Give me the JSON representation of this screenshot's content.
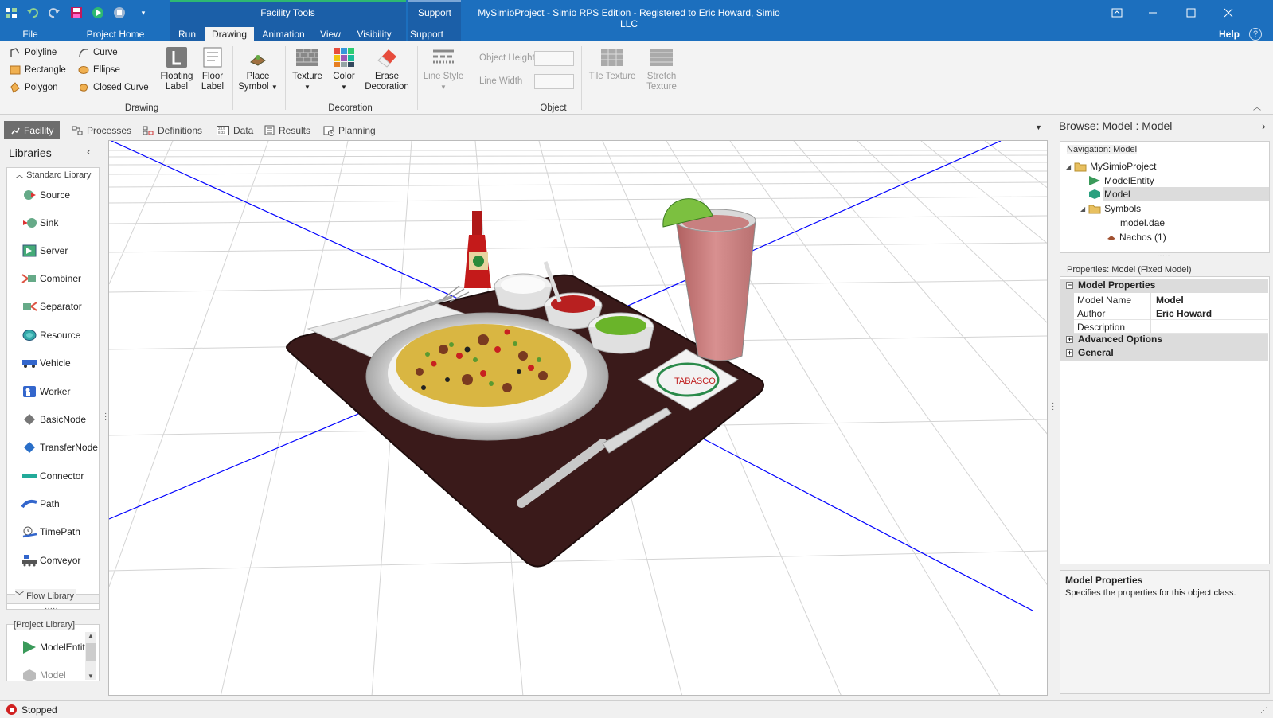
{
  "window": {
    "title": "MySimioProject - Simio RPS Edition - Registered to Eric Howard, Simio LLC",
    "context_facility": "Facility Tools",
    "context_support": "Support"
  },
  "ribbon_tabs": [
    {
      "label": "File"
    },
    {
      "label": "Project Home"
    },
    {
      "label": "Run"
    },
    {
      "label": "Drawing",
      "active": true
    },
    {
      "label": "Animation"
    },
    {
      "label": "View"
    },
    {
      "label": "Visibility"
    },
    {
      "label": "Support"
    }
  ],
  "help_label": "Help",
  "ribbon": {
    "drawing": {
      "polyline": "Polyline",
      "rectangle": "Rectangle",
      "polygon": "Polygon",
      "curve": "Curve",
      "ellipse": "Ellipse",
      "closed_curve": "Closed Curve",
      "floating_label": [
        "Floating",
        "Label"
      ],
      "floor_label": [
        "Floor",
        "Label"
      ],
      "place_symbol": [
        "Place",
        "Symbol"
      ],
      "group": "Drawing"
    },
    "decoration": {
      "texture": "Texture",
      "color": "Color",
      "erase": [
        "Erase",
        "Decoration"
      ],
      "group": "Decoration"
    },
    "object": {
      "line_style": "Line Style",
      "object_height": "Object Height",
      "line_width": "Line Width",
      "tile_texture": "Tile Texture",
      "stretch_texture": [
        "Stretch",
        "Texture"
      ],
      "group": "Object"
    }
  },
  "doc_tabs": [
    {
      "label": "Facility",
      "active": true
    },
    {
      "label": "Processes"
    },
    {
      "label": "Definitions"
    },
    {
      "label": "Data"
    },
    {
      "label": "Results"
    },
    {
      "label": "Planning"
    }
  ],
  "libraries": {
    "title": "Libraries",
    "standard_library": "Standard Library",
    "items": [
      "Source",
      "Sink",
      "Server",
      "Combiner",
      "Separator",
      "Resource",
      "Vehicle",
      "Worker",
      "BasicNode",
      "TransferNode",
      "Connector",
      "Path",
      "TimePath",
      "Conveyor"
    ],
    "flow_library": "Flow Library",
    "project_library": "[Project Library]",
    "project_items": [
      "ModelEntity",
      "Model"
    ]
  },
  "browse": {
    "title": "Browse: Model : Model",
    "navigation_label": "Navigation: Model",
    "tree": {
      "root": "MySimioProject",
      "model_entity": "ModelEntity",
      "model": "Model",
      "symbols": "Symbols",
      "model_dae": "model.dae",
      "nachos": "Nachos (1)"
    }
  },
  "properties": {
    "header": "Properties: Model (Fixed Model)",
    "category_model": "Model Properties",
    "rows": [
      {
        "name": "Model Name",
        "value": "Model"
      },
      {
        "name": "Author",
        "value": "Eric Howard"
      },
      {
        "name": "Description",
        "value": ""
      }
    ],
    "category_advanced": "Advanced Options",
    "category_general": "General",
    "help_title": "Model Properties",
    "help_text": "Specifies the properties for this object class."
  },
  "status": {
    "text": "Stopped",
    "color": "#d02020"
  },
  "colors": {
    "titlebar": "#1c6fbe",
    "context_tab": "#1b5fa8",
    "context_accent": "#2eb872",
    "floor_line": "#0000ff",
    "tray": "#3a1a1a"
  },
  "scene_labels": {
    "coaster": "TABASCO"
  }
}
